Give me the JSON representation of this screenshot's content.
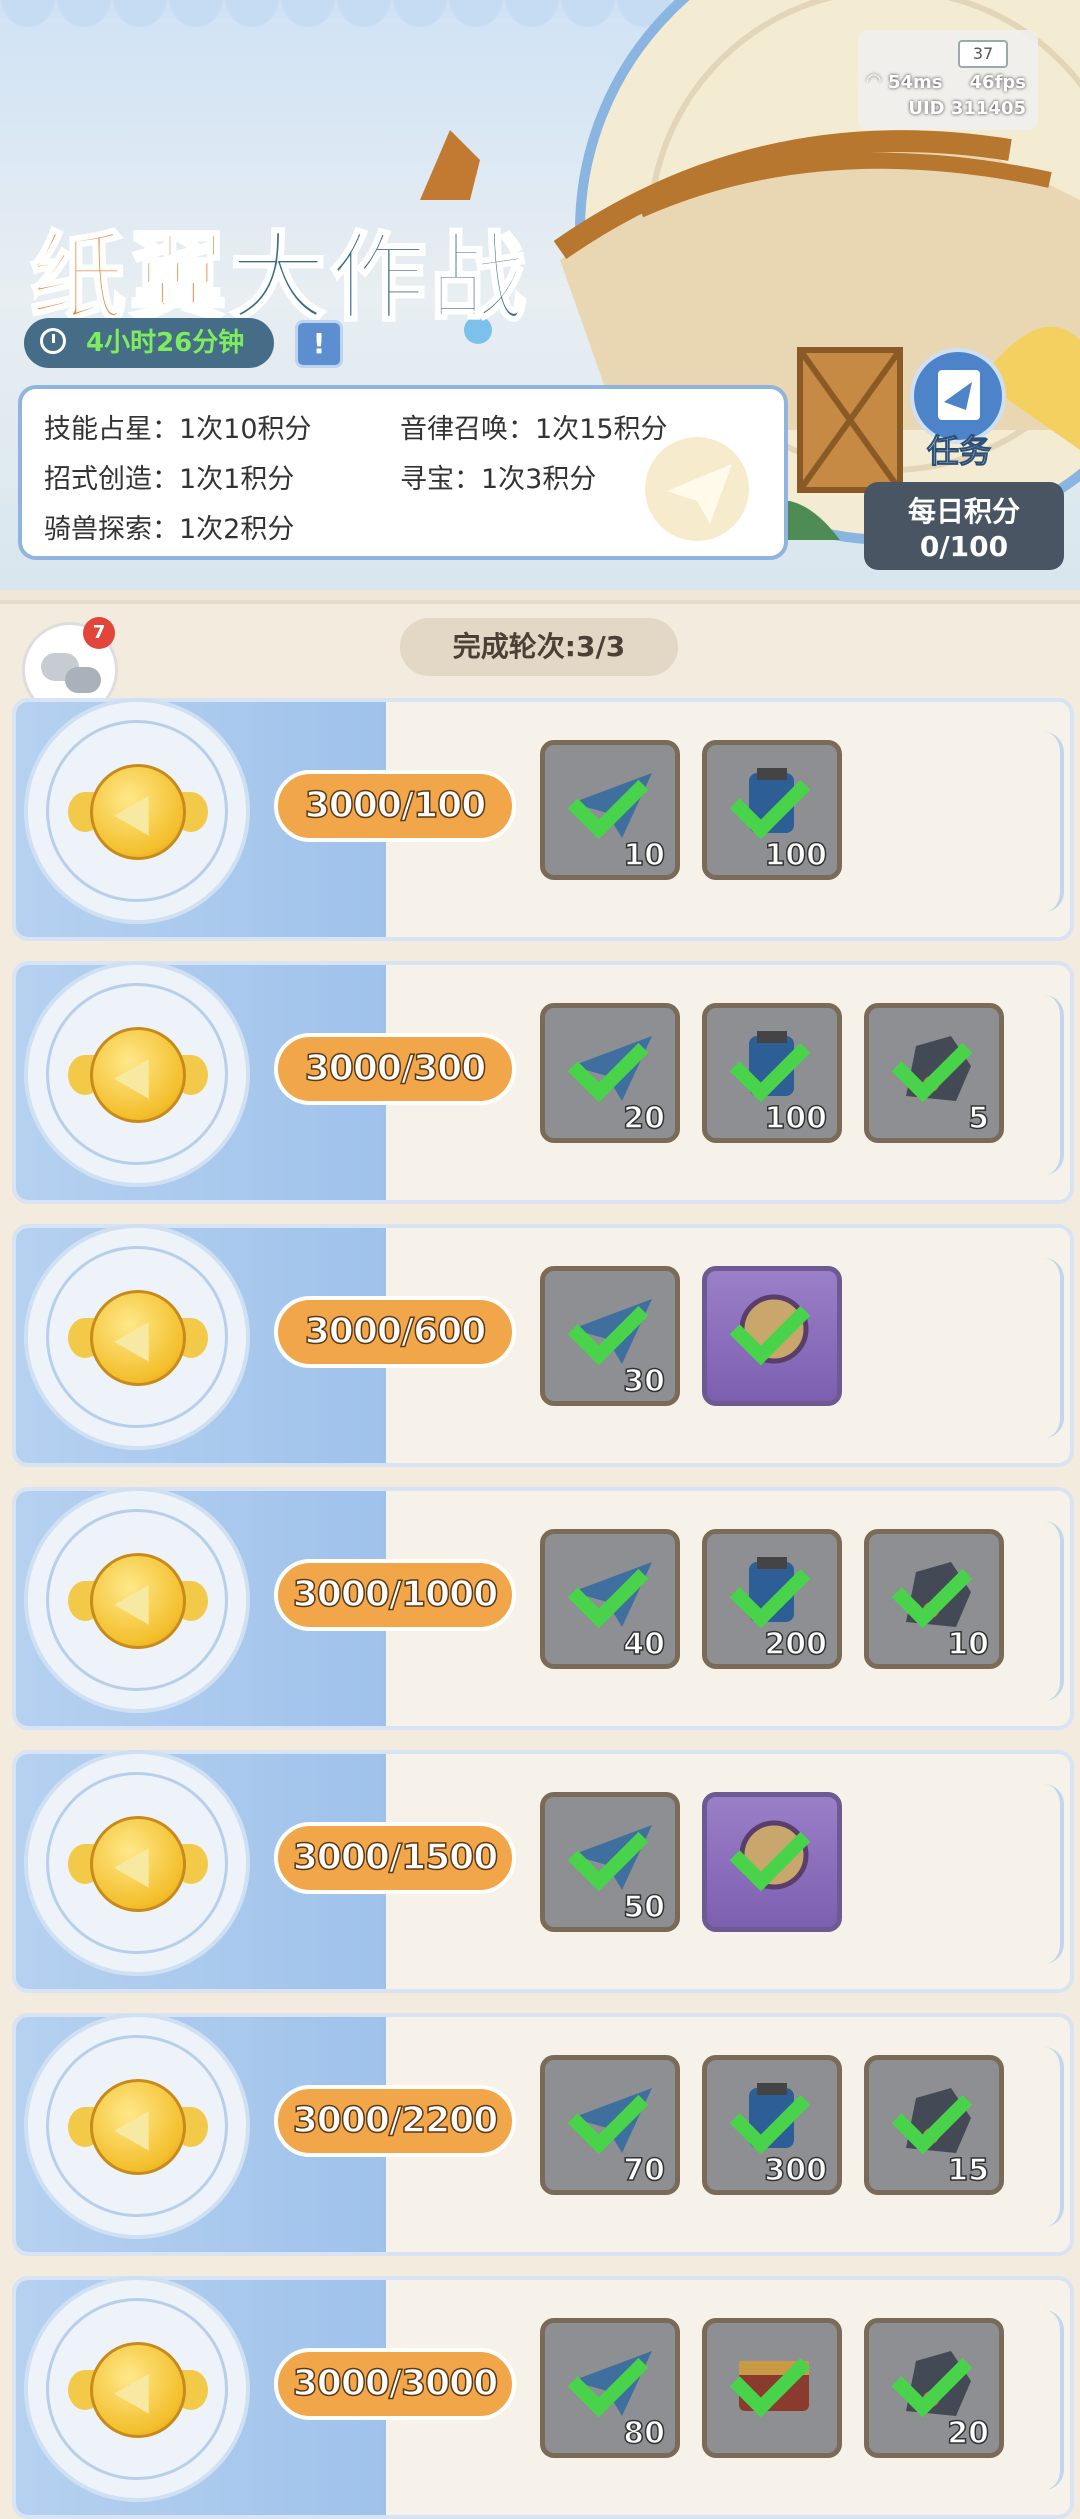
{
  "status_bar": {
    "battery": "37",
    "ping": "54ms",
    "fps": "46fps",
    "uid": "UID 311405"
  },
  "event": {
    "title_part1": "纸翼",
    "title_part2": "大作战",
    "timer": "4小时26分钟"
  },
  "rules": [
    {
      "label": "技能占星：1次10积分"
    },
    {
      "label": "音律召唤：1次15积分"
    },
    {
      "label": "招式创造：1次1积分"
    },
    {
      "label": "寻宝：1次3积分"
    },
    {
      "label": "骑兽探索：1次2积分"
    }
  ],
  "task_button": {
    "label": "任务"
  },
  "daily_points": {
    "label": "每日积分",
    "value": "0/100"
  },
  "chat": {
    "badge": "7"
  },
  "rounds": {
    "label": "完成轮次:3/3"
  },
  "reward_rows": [
    {
      "progress": "3000/100",
      "items": [
        {
          "type": "plane",
          "qty": "10"
        },
        {
          "type": "canister",
          "qty": "100"
        }
      ]
    },
    {
      "progress": "3000/300",
      "items": [
        {
          "type": "plane",
          "qty": "20"
        },
        {
          "type": "canister",
          "qty": "100"
        },
        {
          "type": "ore",
          "qty": "5"
        }
      ]
    },
    {
      "progress": "3000/600",
      "items": [
        {
          "type": "plane",
          "qty": "30"
        },
        {
          "type": "purple-frame",
          "qty": ""
        }
      ]
    },
    {
      "progress": "3000/1000",
      "items": [
        {
          "type": "plane",
          "qty": "40"
        },
        {
          "type": "canister",
          "qty": "200"
        },
        {
          "type": "ore",
          "qty": "10"
        }
      ]
    },
    {
      "progress": "3000/1500",
      "items": [
        {
          "type": "plane",
          "qty": "50"
        },
        {
          "type": "purple-skin",
          "qty": ""
        }
      ]
    },
    {
      "progress": "3000/2200",
      "items": [
        {
          "type": "plane",
          "qty": "70"
        },
        {
          "type": "canister",
          "qty": "300"
        },
        {
          "type": "ore",
          "qty": "15"
        }
      ]
    },
    {
      "progress": "3000/3000",
      "items": [
        {
          "type": "plane",
          "qty": "80"
        },
        {
          "type": "chest",
          "qty": ""
        },
        {
          "type": "ore",
          "qty": "20"
        }
      ]
    }
  ]
}
